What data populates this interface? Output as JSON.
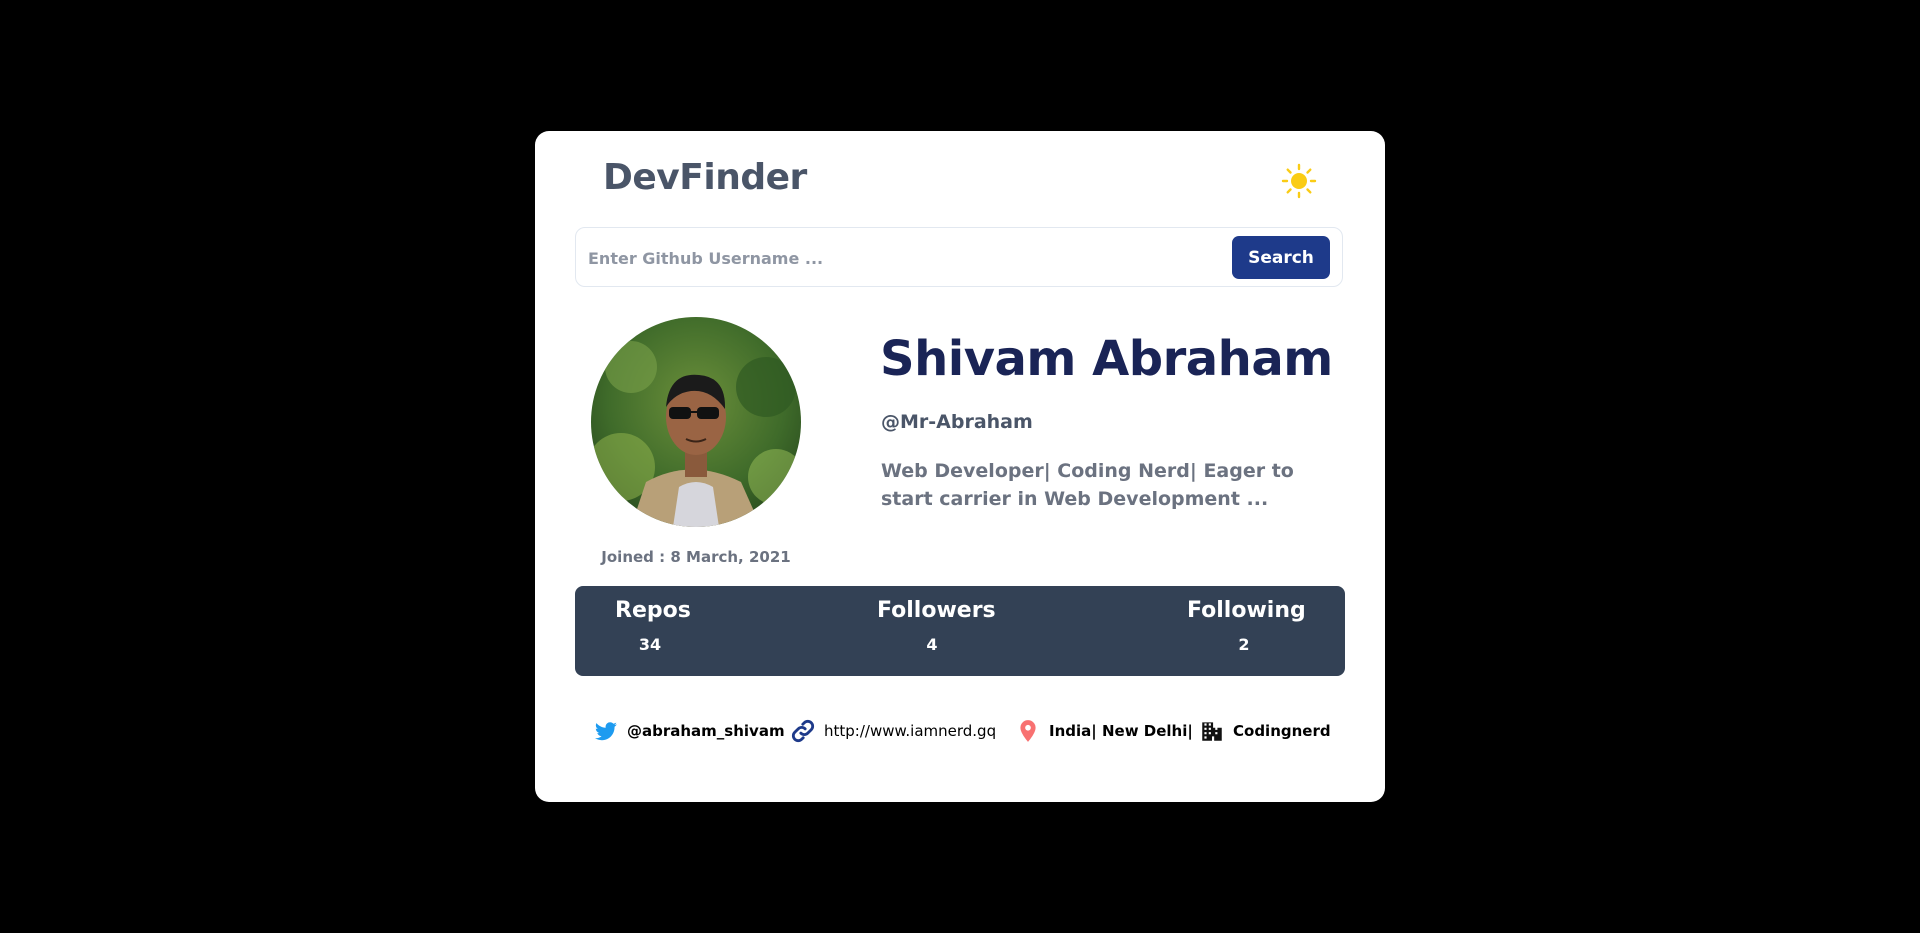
{
  "app": {
    "title": "DevFinder",
    "theme_icon": "sun-icon"
  },
  "search": {
    "placeholder": "Enter Github Username ...",
    "value": "",
    "button_label": "Search"
  },
  "profile": {
    "name": "Shivam Abraham",
    "login": "@Mr-Abraham",
    "bio": "Web Developer| Coding Nerd|  Eager to start carrier in Web Development ...",
    "joined": "Joined : 8 March, 2021",
    "avatar_icon": "avatar-photo"
  },
  "stats": [
    {
      "label": "Repos",
      "value": "34"
    },
    {
      "label": "Followers",
      "value": "4"
    },
    {
      "label": "Following",
      "value": "2"
    }
  ],
  "links": {
    "twitter": {
      "text": "@abraham_shivam",
      "icon": "twitter-icon",
      "color": "#1d9bf0"
    },
    "website": {
      "text": "http://www.iamnerd.gq",
      "icon": "link-icon",
      "color": "#1e3a8a"
    },
    "location": {
      "text": "India| New Delhi|",
      "icon": "location-pin-icon",
      "color": "#f87171"
    },
    "company": {
      "text": "Codingnerd",
      "icon": "building-icon",
      "color": "#111111"
    }
  },
  "colors": {
    "page_background": "#000000",
    "card_background": "#ffffff",
    "accent": "#1e3a8a",
    "stats_background": "#334155",
    "sun": "#facc15"
  }
}
